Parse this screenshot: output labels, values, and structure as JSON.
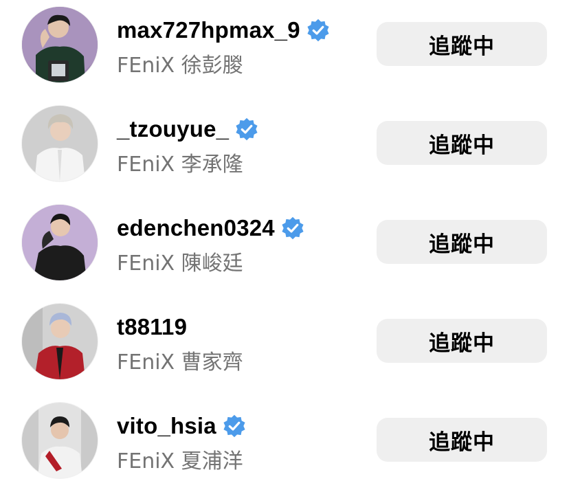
{
  "accent": {
    "verified_badge": "#4C9BEA",
    "button_bg": "#EFEFEF",
    "secondary_text": "#737373"
  },
  "accounts": [
    {
      "username": "max727hpmax_9",
      "full_name": "FEniX 徐彭朡",
      "verified": true,
      "button_label": "追蹤中"
    },
    {
      "username": "_tzouyue_",
      "full_name": "FEniX 李承隆",
      "verified": true,
      "button_label": "追蹤中"
    },
    {
      "username": "edenchen0324",
      "full_name": "FEniX 陳峻廷",
      "verified": true,
      "button_label": "追蹤中"
    },
    {
      "username": "t88119",
      "full_name": "FEniX 曹家齊",
      "verified": false,
      "button_label": "追蹤中"
    },
    {
      "username": "vito_hsia",
      "full_name": "FEniX 夏浦洋",
      "verified": true,
      "button_label": "追蹤中"
    }
  ]
}
